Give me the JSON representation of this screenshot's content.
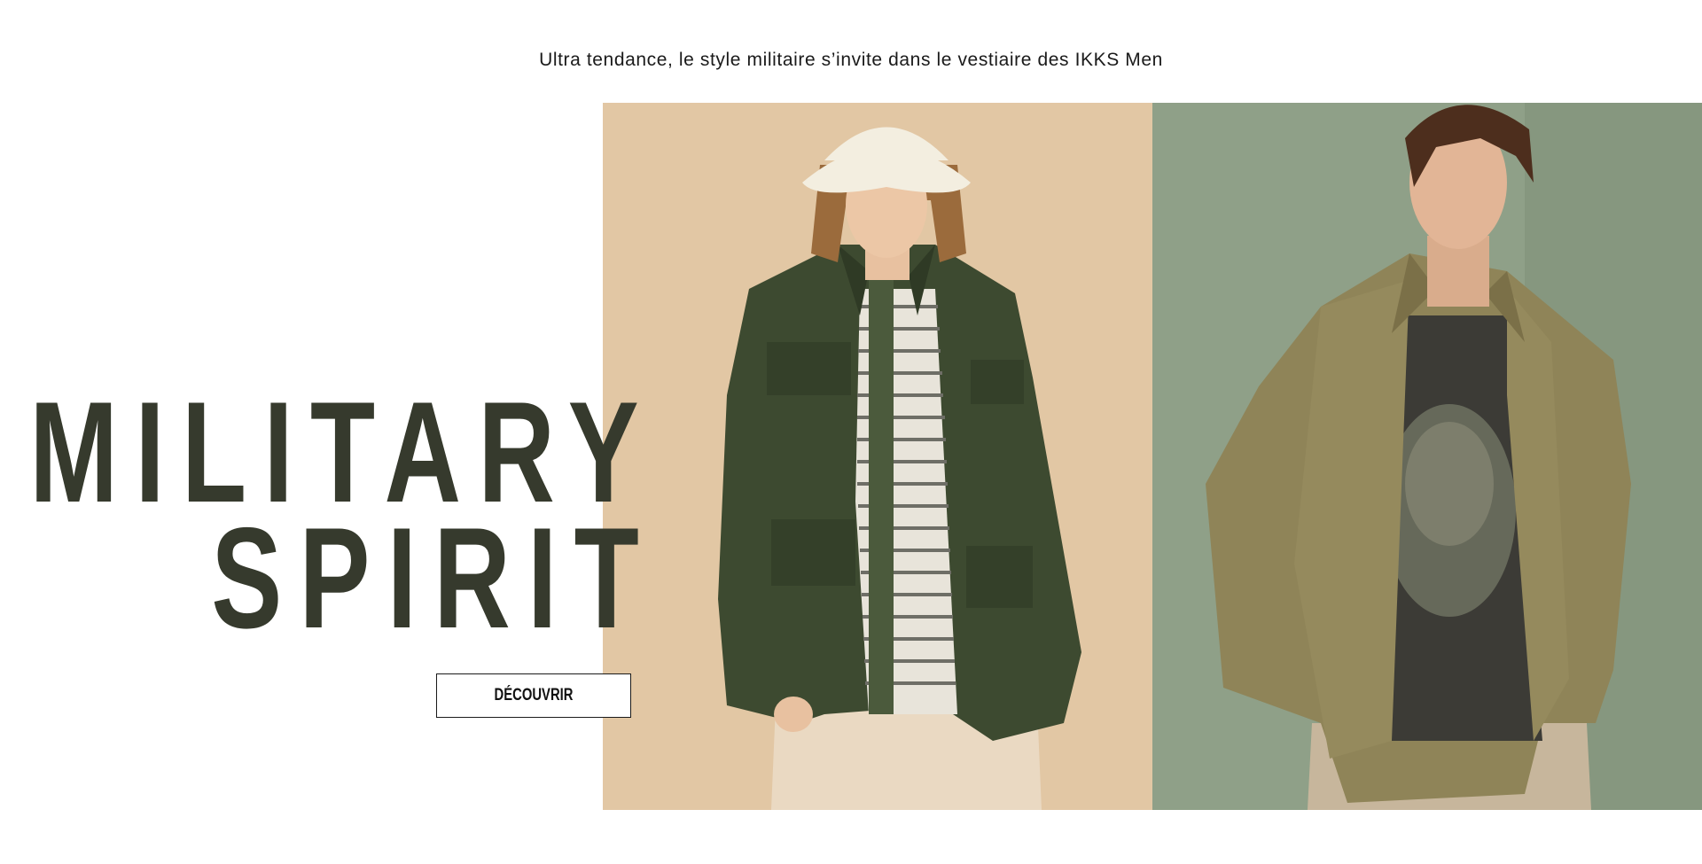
{
  "intro": {
    "text": "Ultra tendance, le style militaire s’invite dans le vestiaire des IKKS Men"
  },
  "hero": {
    "title_line1": "MILITARY",
    "title_line2": "SPIRIT",
    "cta_label": "DÉCOUVRIR"
  },
  "images": {
    "left_alt": "model-in-khaki-field-jacket",
    "right_alt": "model-in-olive-linen-shirt"
  },
  "colors": {
    "title": "#363a2d",
    "left_background": "#e2c7a4",
    "right_background": "#8fa088",
    "page_background": "#ffffff"
  }
}
